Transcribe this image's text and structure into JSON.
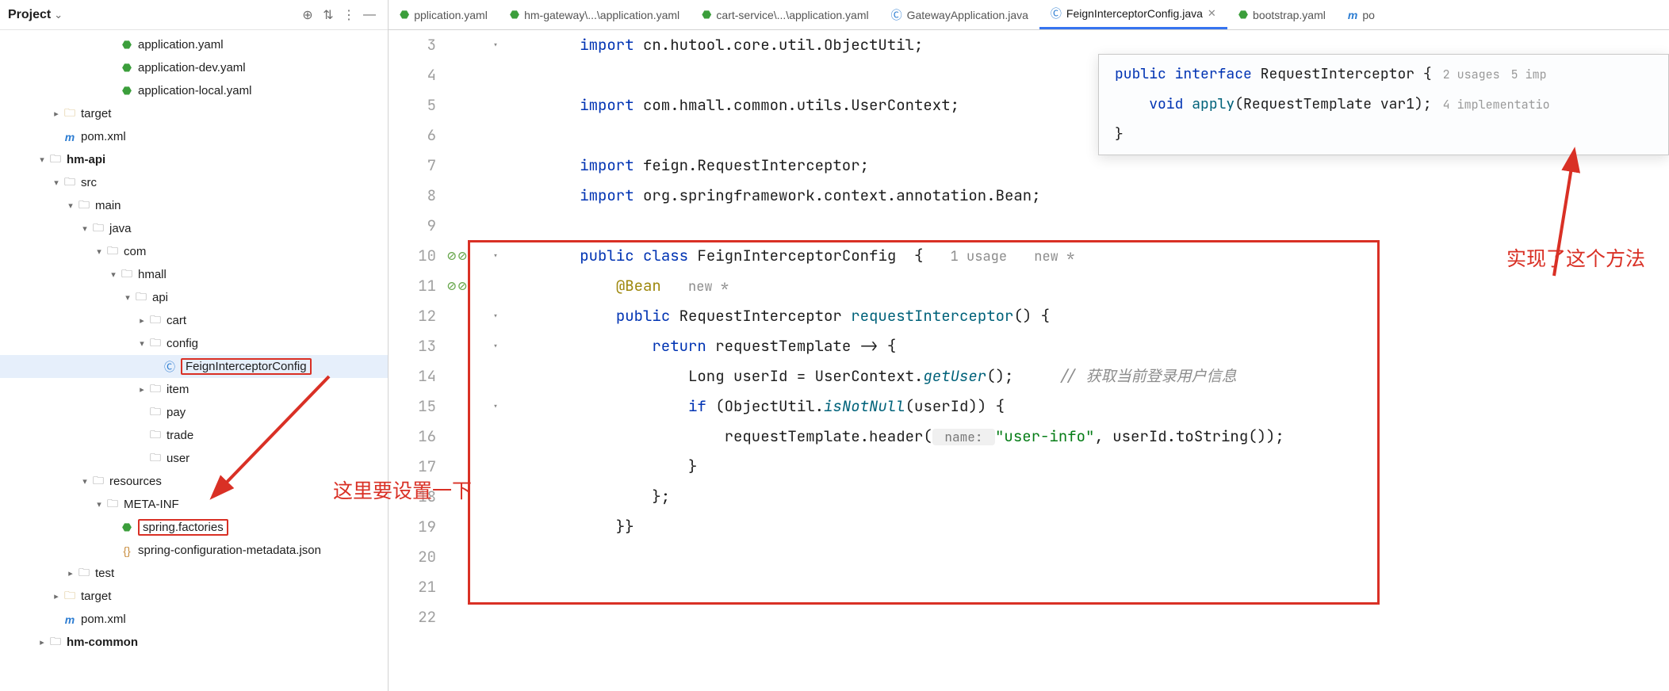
{
  "panel": {
    "title": "Project",
    "tree": [
      {
        "depth": 7,
        "arrow": "",
        "icon": "yaml",
        "label": "application.yaml"
      },
      {
        "depth": 7,
        "arrow": "",
        "icon": "yaml",
        "label": "application-dev.yaml"
      },
      {
        "depth": 7,
        "arrow": "",
        "icon": "yaml",
        "label": "application-local.yaml"
      },
      {
        "depth": 3,
        "arrow": "▸",
        "icon": "folder-y",
        "label": "target"
      },
      {
        "depth": 3,
        "arrow": "",
        "icon": "m",
        "label": "pom.xml"
      },
      {
        "depth": 2,
        "arrow": "▾",
        "icon": "folder",
        "label": "hm-api",
        "bold": true
      },
      {
        "depth": 3,
        "arrow": "▾",
        "icon": "folder",
        "label": "src"
      },
      {
        "depth": 4,
        "arrow": "▾",
        "icon": "folder",
        "label": "main"
      },
      {
        "depth": 5,
        "arrow": "▾",
        "icon": "folder",
        "label": "java"
      },
      {
        "depth": 6,
        "arrow": "▾",
        "icon": "folder",
        "label": "com"
      },
      {
        "depth": 7,
        "arrow": "▾",
        "icon": "folder",
        "label": "hmall"
      },
      {
        "depth": 8,
        "arrow": "▾",
        "icon": "folder",
        "label": "api"
      },
      {
        "depth": 9,
        "arrow": "▸",
        "icon": "folder",
        "label": "cart"
      },
      {
        "depth": 9,
        "arrow": "▾",
        "icon": "folder",
        "label": "config"
      },
      {
        "depth": 10,
        "arrow": "",
        "icon": "java",
        "label": "FeignInterceptorConfig",
        "sel": true,
        "boxed": true
      },
      {
        "depth": 9,
        "arrow": "▸",
        "icon": "folder",
        "label": "item"
      },
      {
        "depth": 9,
        "arrow": "",
        "icon": "folder",
        "label": "pay"
      },
      {
        "depth": 9,
        "arrow": "",
        "icon": "folder",
        "label": "trade"
      },
      {
        "depth": 9,
        "arrow": "",
        "icon": "folder",
        "label": "user"
      },
      {
        "depth": 5,
        "arrow": "▾",
        "icon": "folder",
        "label": "resources"
      },
      {
        "depth": 6,
        "arrow": "▾",
        "icon": "folder",
        "label": "META-INF"
      },
      {
        "depth": 7,
        "arrow": "",
        "icon": "yaml",
        "label": "spring.factories",
        "boxed": true
      },
      {
        "depth": 7,
        "arrow": "",
        "icon": "json",
        "label": "spring-configuration-metadata.json"
      },
      {
        "depth": 4,
        "arrow": "▸",
        "icon": "folder",
        "label": "test"
      },
      {
        "depth": 3,
        "arrow": "▸",
        "icon": "folder-y",
        "label": "target"
      },
      {
        "depth": 3,
        "arrow": "",
        "icon": "m",
        "label": "pom.xml"
      },
      {
        "depth": 2,
        "arrow": "▸",
        "icon": "folder",
        "label": "hm-common",
        "bold": true
      }
    ]
  },
  "tabs": [
    {
      "icon": "yaml",
      "label": "pplication.yaml"
    },
    {
      "icon": "yaml",
      "label": "hm-gateway\\...\\application.yaml"
    },
    {
      "icon": "yaml",
      "label": "cart-service\\...\\application.yaml"
    },
    {
      "icon": "java",
      "label": "GatewayApplication.java"
    },
    {
      "icon": "java",
      "label": "FeignInterceptorConfig.java",
      "active": true,
      "close": true
    },
    {
      "icon": "yaml",
      "label": "bootstrap.yaml"
    },
    {
      "icon": "m",
      "label": "po"
    }
  ],
  "lineStart": 3,
  "lineCount": 20,
  "gutterIcons": {
    "10": "dbl-circ",
    "11": "dbl-circ"
  },
  "fold": {
    "3": "▾",
    "10": "▾",
    "11": "",
    "12": "▾",
    "13": "▾",
    "15": "▾"
  },
  "code": {
    "l3": {
      "pre": "        ",
      "kw": "import",
      "rest": " cn.hutool.core.util.ObjectUtil;"
    },
    "l5": {
      "pre": "        ",
      "kw": "import",
      "rest": " com.hmall.common.utils.UserContext;"
    },
    "l7": {
      "pre": "        ",
      "kw": "import",
      "rest": " feign.RequestInterceptor;"
    },
    "l8": {
      "pre": "        ",
      "kw": "import",
      "rest": " org.springframework.context.annotation.Bean;"
    },
    "l10": {
      "pre": "        ",
      "kw1": "public",
      "kw2": "class",
      "cls": "FeignInterceptorConfig",
      "brace": "  {",
      "hint1": "1 usage",
      "hint2": "new *"
    },
    "l11": {
      "pre": "            ",
      "ann": "@Bean",
      "hint": "new *"
    },
    "l12": {
      "pre": "            ",
      "kw": "public",
      "type": " RequestInterceptor ",
      "mtd": "requestInterceptor",
      "rest": "() {"
    },
    "l13": {
      "pre": "                ",
      "kw": "return",
      "rest": " requestTemplate -> {"
    },
    "l14": {
      "pre": "                    Long userId = UserContext.",
      "mtd": "getUser",
      "post": "();",
      "cmt": "     // 获取当前登录用户信息"
    },
    "l15": {
      "pre": "                    ",
      "kw": "if",
      "mid": " (ObjectUtil.",
      "mtd": "isNotNull",
      "rest": "(userId)) {"
    },
    "l16": {
      "pre": "                        requestTemplate.header(",
      "phint": " name: ",
      "str": "\"user-info\"",
      "rest": ", userId.toString());"
    },
    "l17": {
      "txt": "                    }"
    },
    "l18": {
      "txt": "                };"
    },
    "l19": {
      "txt": "            }}"
    }
  },
  "popup": {
    "l1_kw1": "public",
    "l1_kw2": "interface",
    "l1_name": "RequestInterceptor",
    "l1_brace": " {",
    "l1_u": "2 usages",
    "l1_i": "5 imp",
    "l2_kw": "void",
    "l2_mtd": "apply",
    "l2_rest": "(RequestTemplate var1);",
    "l2_i": "4 implementatio",
    "l3": "}"
  },
  "annot": {
    "left": "这里要设置一下",
    "right": "实现了这个方法"
  }
}
